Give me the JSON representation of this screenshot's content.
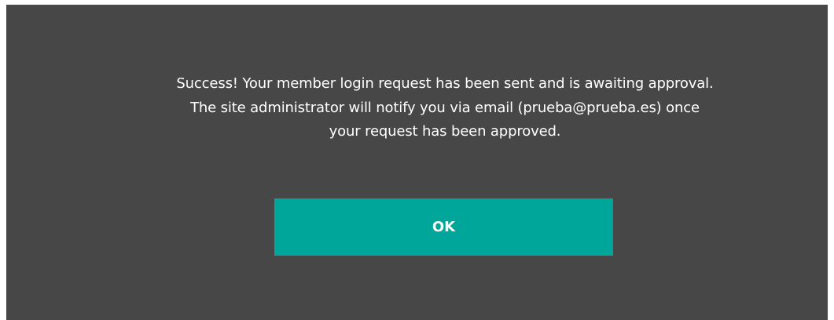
{
  "dialog": {
    "message_lines": [
      "Success! Your member login request has been sent and is awaiting approval.",
      "The site administrator will notify you via email (prueba@prueba.es) once",
      "your request has been approved."
    ],
    "ok_label": "OK"
  },
  "colors": {
    "dialog_background": "#484747",
    "button_background": "#00a69a",
    "text": "#ffffff"
  }
}
